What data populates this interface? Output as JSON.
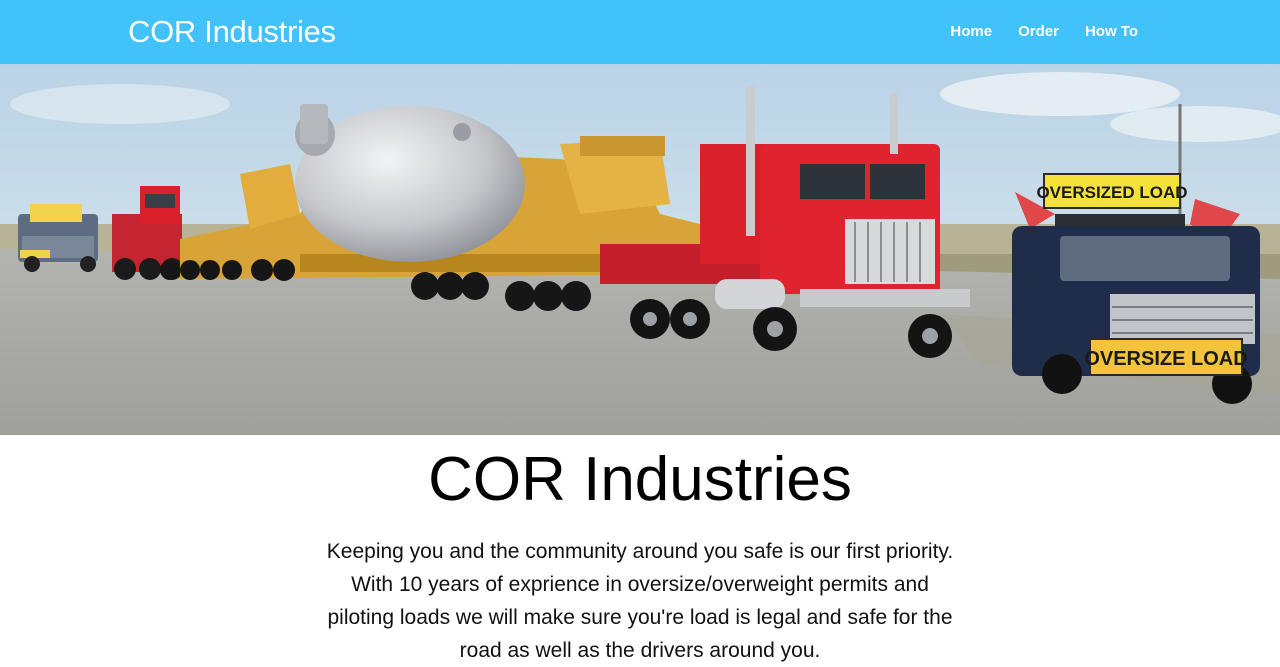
{
  "nav": {
    "brand": "COR Industries",
    "links": [
      {
        "label": "Home"
      },
      {
        "label": "Order"
      },
      {
        "label": "How To"
      }
    ]
  },
  "hero": {
    "sign_top": "OVERSIZED LOAD",
    "sign_bumper": "OVERSIZE LOAD",
    "colors": {
      "sky": "#cfe0ec",
      "road": "#a9aaa6",
      "truck_red": "#d9202b",
      "trailer_yellow": "#d9a437",
      "tank_silver": "#c8cace",
      "pickup_blue": "#1f2d4a",
      "sign_yellow": "#f4e23a"
    }
  },
  "main": {
    "title": "COR Industries",
    "description": "Keeping you and the community around you safe is our first priority. With 10 years of exprience in oversize/overweight permits and piloting loads we will make sure you're load is legal and safe for the road as well as the drivers around you."
  },
  "theme": {
    "navbar_bg": "#41c2fb"
  }
}
